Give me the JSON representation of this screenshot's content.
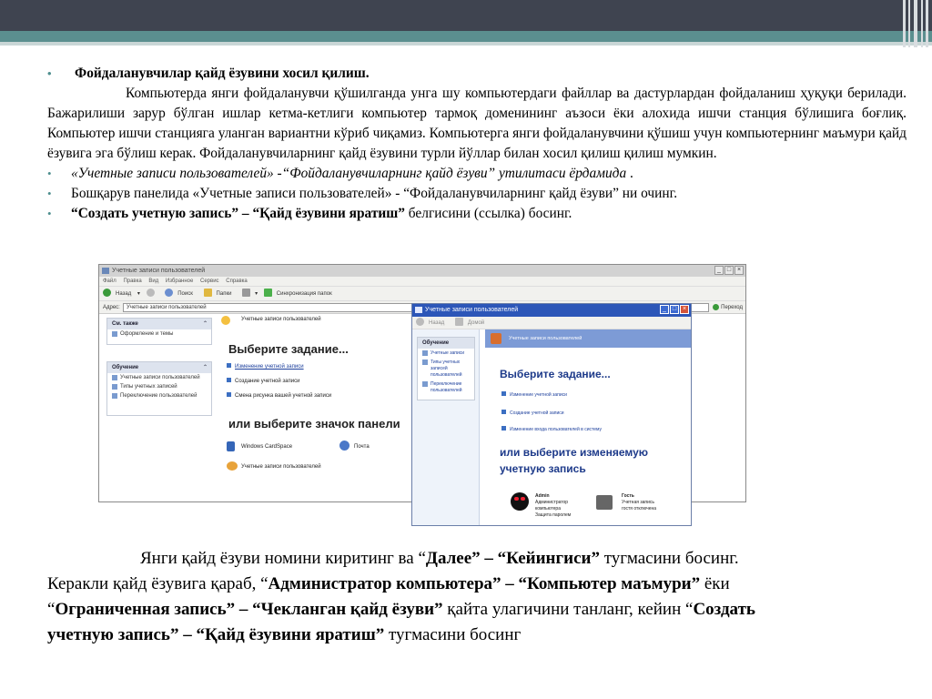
{
  "bullets_top": {
    "heading": "Фойдаланувчилар қайд ёзувини хосил қилиш.",
    "paragraph": "Компьютерда янги фойдаланувчи қўшилганда унга шу компьютердаги файллар ва дастурлардан фойдаланиш ҳуқуқи берилади. Бажарилиши зарур бўлган ишлар кетма-кетлиги компьютер тармоқ доменининг аъзоси ёки алохида ишчи станция бўлишига боғлиқ.  Компьютер ишчи станцияга уланган вариантни кўриб чиқамиз. Компьютерга янги фойдаланувчини қўшиш учун компьютернинг маъмури қайд ёзувига эга бўлиш керак. Фойдаланувчиларнинг қайд ёзувини турли йўллар билан хосил қилиш қилиш мумкин.",
    "b2_italic": "«Учетные записи пользователей» -“Фойдаланувчиларнинг қайд ёзуви” утилитаси ёрдамида",
    "b2_tail": " .",
    "b3": "Бошқарув панелида «Учетные записи пользователей» - “Фойдаланувчиларнинг қайд ёзуви” ни очинг.",
    "b4_bold": "“Создать учетную запись” – “Қайд ёзувини яратиш”",
    "b4_tail": " белгисини (ссылка) босинг."
  },
  "shot1": {
    "title": "Учетные записи пользователей",
    "menu": [
      "Файл",
      "Правка",
      "Вид",
      "Избранное",
      "Сервис",
      "Справка"
    ],
    "toolbar": [
      "Назад",
      "Поиск",
      "Папки",
      "Синхронизация папок"
    ],
    "address_label": "Адрес:",
    "address_value": "Учетные записи пользователей",
    "go_label": "Переход",
    "panel1_title": "См. также",
    "panel1_items": [
      "Оформление и темы"
    ],
    "panel2_title": "Обучение",
    "panel2_items": [
      "Учетные записи пользователей",
      "Типы учетных записей",
      "Переключение пользователей"
    ],
    "header": "Учетные записи пользователей",
    "choose_task": "Выберите задание...",
    "tasks": [
      "Изменение учетной записи",
      "Создание учетной записи",
      "Смена рисунка вашей учетной записи"
    ],
    "or_choose": "или выберите значок панели",
    "icons": [
      "Windows CardSpace",
      "Почта",
      "Учетные записи пользователей"
    ]
  },
  "shot2": {
    "title": "Учетные записи пользователей",
    "toolbar": [
      "Назад",
      "Домой"
    ],
    "panel_title": "Обучение",
    "panel_items": [
      "Учетные записи",
      "Типы учетных записей пользователей",
      "Переключение пользователей"
    ],
    "header": "Учетные записи пользователей",
    "choose_task": "Выберите задание...",
    "tasks": [
      "Изменение учетной записи",
      "Создание учетной записи",
      "Изменение входа пользователей в систему"
    ],
    "or_choose_1": "или выберите изменяемую",
    "or_choose_2": "учетную запись",
    "acc1_name": "Admin",
    "acc1_l1": "Администратор",
    "acc1_l2": "компьютера",
    "acc1_l3": "Защита паролем",
    "acc2_name": "Гость",
    "acc2_l1": "Учетная запись",
    "acc2_l2": "гостя отключена"
  },
  "lower": {
    "l1_a": "Янги қайд ёзуви номини киритинг ва  “",
    "l1_b": "Далее” – “Кейингиси”",
    "l1_c": " тугмасини босинг.",
    "l2_a": "Керакли қайд ёзувига қараб, “",
    "l2_b": "Администратор компьютера” – “Компьютер маъмури”",
    "l2_c": " ёки",
    "l3_a": "“",
    "l3_b": "Ограниченная запись” – “Чекланган қайд ёзуви”",
    "l3_c": " қайта улагичини танланг, кейин “",
    "l3_d": "Создать",
    "l4_b": "учетную запись” – “Қайд ёзувини яратиш”",
    "l4_c": " тугмасини босинг"
  },
  "colors": {
    "top_dark": "#3f4450",
    "top_teal": "#5b8f8f",
    "bullet": "#4f8f8f",
    "xp_blue": "#2455b0"
  }
}
